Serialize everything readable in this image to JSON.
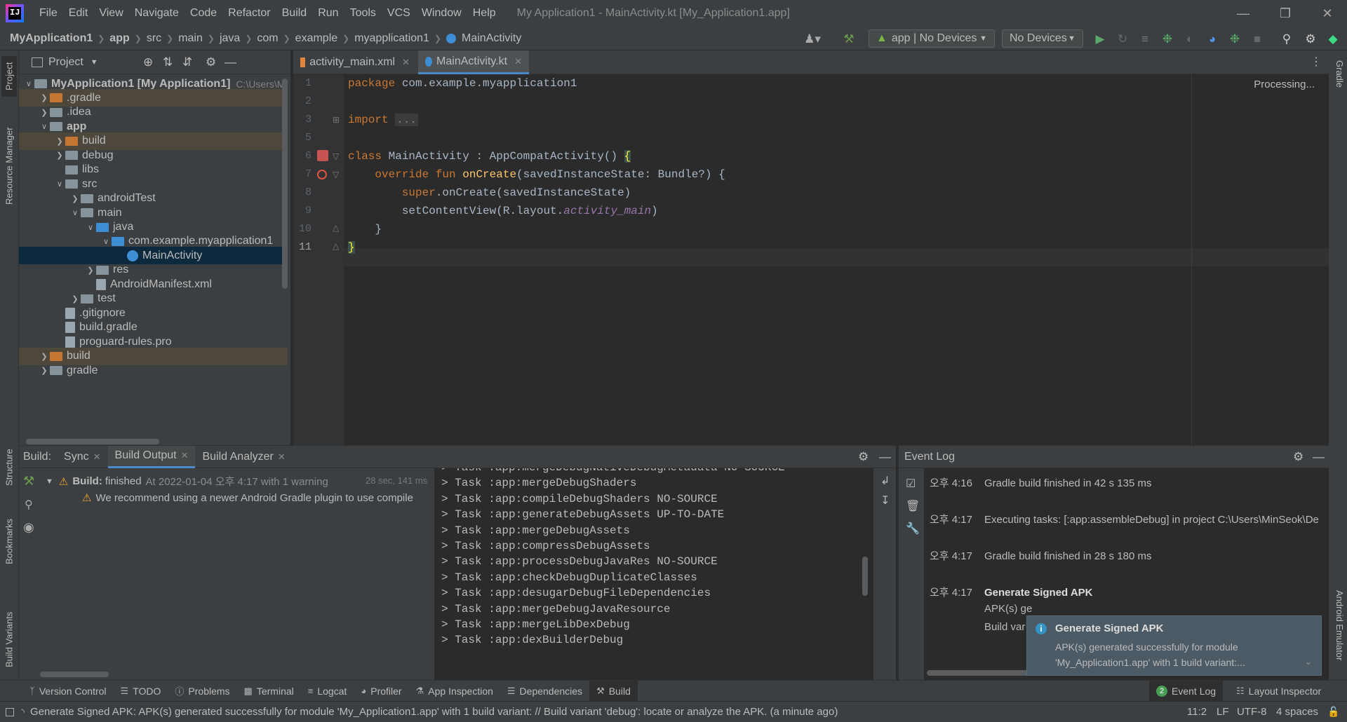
{
  "menu": [
    "File",
    "Edit",
    "View",
    "Navigate",
    "Code",
    "Refactor",
    "Build",
    "Run",
    "Tools",
    "VCS",
    "Window",
    "Help"
  ],
  "window_title": "My Application1 - MainActivity.kt [My_Application1.app]",
  "breadcrumbs": [
    "MyApplication1",
    "app",
    "src",
    "main",
    "java",
    "com",
    "example",
    "myapplication1",
    "MainActivity"
  ],
  "run_config": "app | No Devices",
  "device_select": "No Devices",
  "project_panel": {
    "title": "Project"
  },
  "tree": [
    {
      "label": "MyApplication1 [My Application1]",
      "extra": "C:\\Users\\Mi",
      "indent": 0,
      "arrow": "open",
      "icon": "module",
      "hl": false
    },
    {
      "label": ".gradle",
      "indent": 1,
      "arrow": "closed",
      "icon": "folder-orange",
      "hl": true
    },
    {
      "label": ".idea",
      "indent": 1,
      "arrow": "closed",
      "icon": "folder",
      "hl": false
    },
    {
      "label": "app",
      "indent": 1,
      "arrow": "open",
      "icon": "folder-module",
      "hl": false,
      "bold": true
    },
    {
      "label": "build",
      "indent": 2,
      "arrow": "closed",
      "icon": "folder-orange",
      "hl": true
    },
    {
      "label": "debug",
      "indent": 2,
      "arrow": "closed",
      "icon": "folder",
      "hl": false
    },
    {
      "label": "libs",
      "indent": 2,
      "arrow": "",
      "icon": "folder",
      "hl": false
    },
    {
      "label": "src",
      "indent": 2,
      "arrow": "open",
      "icon": "folder",
      "hl": false
    },
    {
      "label": "androidTest",
      "indent": 3,
      "arrow": "closed",
      "icon": "folder",
      "hl": false
    },
    {
      "label": "main",
      "indent": 3,
      "arrow": "open",
      "icon": "folder",
      "hl": false
    },
    {
      "label": "java",
      "indent": 4,
      "arrow": "open",
      "icon": "folder-blue",
      "hl": false
    },
    {
      "label": "com.example.myapplication1",
      "indent": 5,
      "arrow": "open",
      "icon": "package",
      "hl": false
    },
    {
      "label": "MainActivity",
      "indent": 6,
      "arrow": "",
      "icon": "kotlin",
      "hl": false,
      "selected": true
    },
    {
      "label": "res",
      "indent": 4,
      "arrow": "closed",
      "icon": "folder-res",
      "hl": false
    },
    {
      "label": "AndroidManifest.xml",
      "indent": 4,
      "arrow": "",
      "icon": "manifest",
      "hl": false
    },
    {
      "label": "test",
      "indent": 3,
      "arrow": "closed",
      "icon": "folder",
      "hl": false
    },
    {
      "label": ".gitignore",
      "indent": 2,
      "arrow": "",
      "icon": "file",
      "hl": false
    },
    {
      "label": "build.gradle",
      "indent": 2,
      "arrow": "",
      "icon": "gradle",
      "hl": false
    },
    {
      "label": "proguard-rules.pro",
      "indent": 2,
      "arrow": "",
      "icon": "file",
      "hl": false
    },
    {
      "label": "build",
      "indent": 1,
      "arrow": "closed",
      "icon": "folder-orange",
      "hl": true
    },
    {
      "label": "gradle",
      "indent": 1,
      "arrow": "closed",
      "icon": "folder",
      "hl": false
    }
  ],
  "editor_tabs": [
    {
      "label": "activity_main.xml",
      "active": false
    },
    {
      "label": "MainActivity.kt",
      "active": true
    }
  ],
  "editor_status": "Processing...",
  "code": {
    "line_numbers": [
      "1",
      "2",
      "3",
      "5",
      "6",
      "7",
      "8",
      "9",
      "10",
      "11"
    ],
    "l1_kw": "package",
    "l1_rest": " com.example.myapplication1",
    "l3_kw": "import",
    "l3_fold": "...",
    "l6_kw": "class",
    "l6_rest": " MainActivity : AppCompatActivity() ",
    "l6_brace": "{",
    "l7_kw": "override fun",
    "l7_fn": "onCreate",
    "l7_rest": "(savedInstanceState: Bundle?) {",
    "l8_kw": "super",
    "l8_rest": ".onCreate(savedInstanceState)",
    "l9_pre": "setContentView(R.layout.",
    "l9_it": "activity_main",
    "l9_post": ")",
    "l10": "}",
    "l11": "}"
  },
  "build_panel": {
    "label": "Build:",
    "tabs": [
      "Sync",
      "Build Output",
      "Build Analyzer"
    ],
    "status_title": "Build:",
    "status_text": "finished",
    "status_meta": "At 2022-01-04 오후 4:17 with 1 warning",
    "status_time": "28 sec, 141 ms",
    "warning": "We recommend using a newer Android Gradle plugin to use compile"
  },
  "build_output": [
    "> Task :app:mergeDebugNativeDebugMetadata NO-SOURCE",
    "> Task :app:mergeDebugShaders",
    "> Task :app:compileDebugShaders NO-SOURCE",
    "> Task :app:generateDebugAssets UP-TO-DATE",
    "> Task :app:mergeDebugAssets",
    "> Task :app:compressDebugAssets",
    "> Task :app:processDebugJavaRes NO-SOURCE",
    "> Task :app:checkDebugDuplicateClasses",
    "> Task :app:desugarDebugFileDependencies",
    "> Task :app:mergeDebugJavaResource",
    "> Task :app:mergeLibDexDebug",
    "> Task :app:dexBuilderDebug"
  ],
  "event_log": {
    "title": "Event Log",
    "entries": [
      {
        "time": "오후 4:16",
        "text": "Gradle build finished in 42 s 135 ms",
        "bold": false
      },
      {
        "time": "오후 4:17",
        "text": "Executing tasks: [:app:assembleDebug] in project C:\\Users\\MinSeok\\De",
        "bold": false
      },
      {
        "time": "오후 4:17",
        "text": "Gradle build finished in 28 s 180 ms",
        "bold": false
      },
      {
        "time": "오후 4:17",
        "text": "Generate Signed APK",
        "bold": true
      }
    ],
    "partial_1": "APK(s) ge",
    "partial_2": "Build var"
  },
  "notification": {
    "title": "Generate Signed APK",
    "line1": "APK(s) generated successfully for module",
    "line2": "'My_Application1.app' with 1 build variant:..."
  },
  "bottom_tools": [
    "Version Control",
    "TODO",
    "Problems",
    "Terminal",
    "Logcat",
    "Profiler",
    "App Inspection",
    "Dependencies",
    "Build"
  ],
  "bottom_right": {
    "event_log": "Event Log",
    "event_count": "2",
    "layout_inspector": "Layout Inspector"
  },
  "status": {
    "message": "Generate Signed APK: APK(s) generated successfully for module 'My_Application1.app' with 1 build variant: // Build variant 'debug': locate or analyze the APK. (a minute ago)",
    "position": "11:2",
    "line_sep": "LF",
    "encoding": "UTF-8",
    "indent": "4 spaces"
  },
  "side_tabs": {
    "left": [
      "Project",
      "Resource Manager",
      "Structure",
      "Bookmarks",
      "Build Variants"
    ],
    "right": [
      "Gradle",
      "Android Emulator"
    ]
  }
}
